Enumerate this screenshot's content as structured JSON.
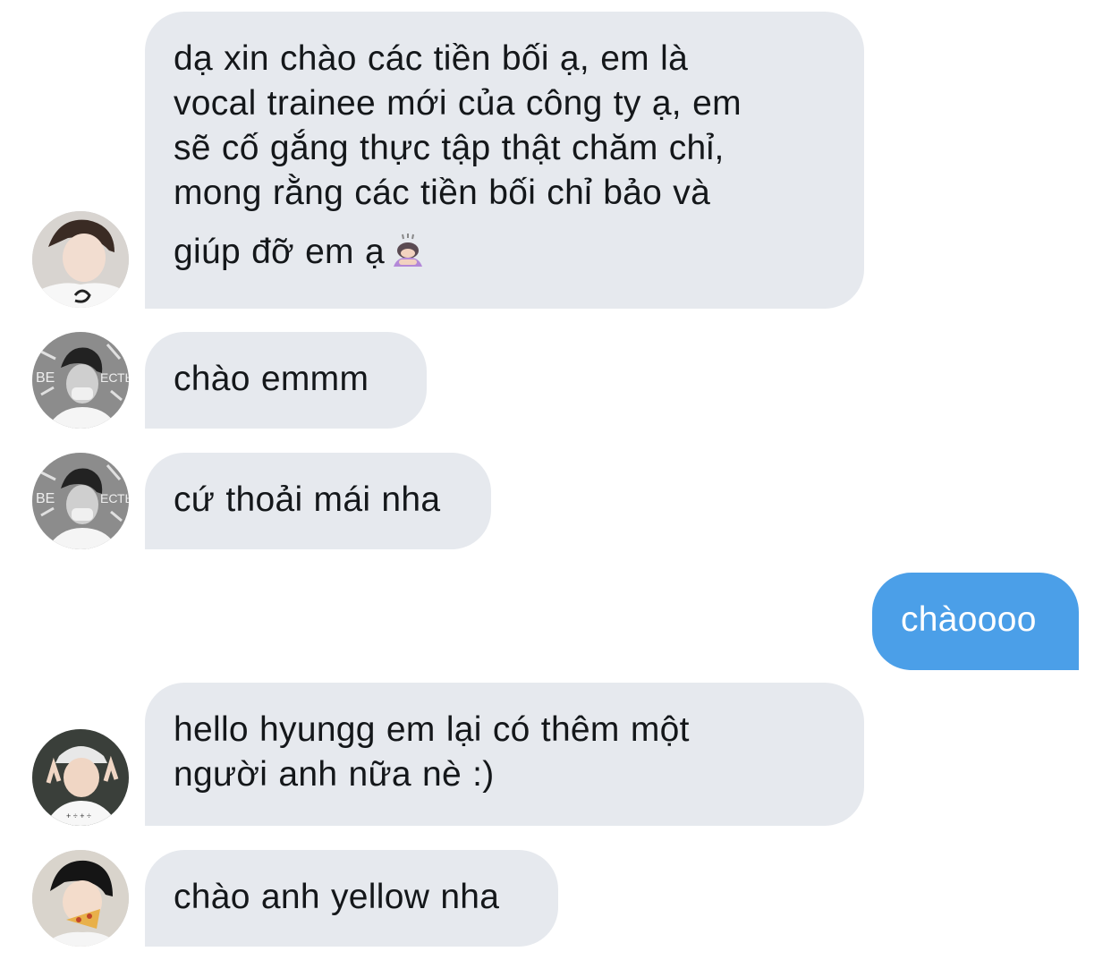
{
  "conversation": {
    "messages": [
      {
        "side": "incoming",
        "avatar": "avatar-trainee",
        "lines": [
          "dạ xin chào các tiền bối ạ, em là",
          "vocal trainee mới của công ty ạ, em",
          "sẽ cố gắng thực tập thật chăm chỉ,",
          "mong rằng các tiền bối chỉ bảo và",
          "giúp đỡ em ạ"
        ],
        "emoji": "bowing-person-emoji"
      },
      {
        "side": "incoming",
        "avatar": "avatar-grayscale",
        "lines": [
          "chào emmm"
        ]
      },
      {
        "side": "incoming",
        "avatar": "avatar-grayscale",
        "lines": [
          "cứ thoải mái nha"
        ]
      },
      {
        "side": "outgoing",
        "lines": [
          "chàoooo"
        ]
      },
      {
        "side": "incoming",
        "avatar": "avatar-cap-boy",
        "lines": [
          "hello hyungg em lại có thêm một",
          "người anh nữa nè :)"
        ]
      },
      {
        "side": "incoming",
        "avatar": "avatar-pizza-boy",
        "lines": [
          "chào anh yellow nha"
        ]
      }
    ]
  },
  "colors": {
    "incoming_bubble": "#e6e9ee",
    "outgoing_bubble": "#4b9fe8",
    "incoming_text": "#14171a",
    "outgoing_text": "#ffffff"
  }
}
